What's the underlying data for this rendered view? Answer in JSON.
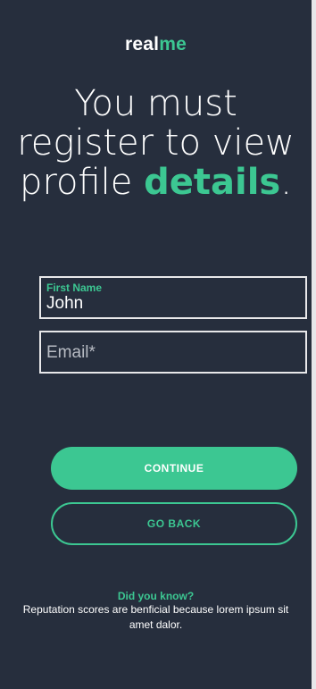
{
  "app": {
    "logo_prefix": "real",
    "logo_accent": "me"
  },
  "headline": {
    "line1": "You must",
    "line2": "register to view",
    "line3_prefix": "profile ",
    "line3_highlight": "details",
    "line3_suffix": "."
  },
  "form": {
    "first_name": {
      "label": "First Name",
      "value": "John"
    },
    "email": {
      "placeholder": "Email*",
      "value": ""
    }
  },
  "buttons": {
    "continue_label": "CONTINUE",
    "go_back_label": "GO BACK"
  },
  "tip": {
    "title": "Did you know?",
    "body": "Reputation scores are benficial because lorem ipsum sit amet dalor."
  },
  "colors": {
    "background": "#262e3d",
    "accent": "#3cc792",
    "text": "#ffffff"
  }
}
